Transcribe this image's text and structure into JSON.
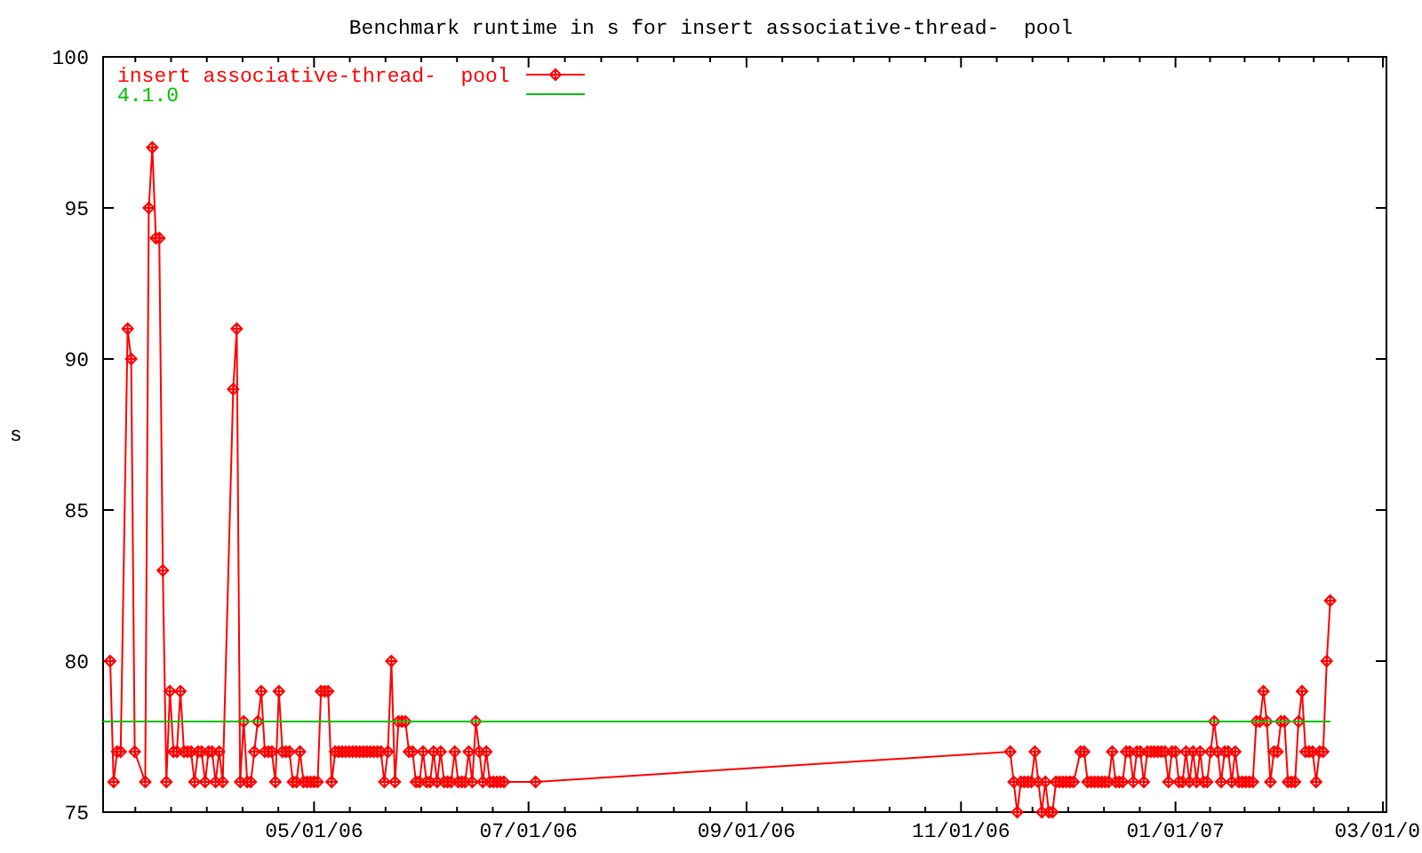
{
  "chart": {
    "chart_data": {
      "type": "line",
      "title": "Benchmark runtime in s for insert associative-thread-  pool",
      "ylabel": "s",
      "xlim": [
        "2006-03-02",
        "2007-03-02"
      ],
      "ylim": [
        75,
        100
      ],
      "xticks": [
        {
          "value": "2006-05-01",
          "label": "05/01/06"
        },
        {
          "value": "2006-07-01",
          "label": "07/01/06"
        },
        {
          "value": "2006-09-01",
          "label": "09/01/06"
        },
        {
          "value": "2006-11-01",
          "label": "11/01/06"
        },
        {
          "value": "2007-01-01",
          "label": "01/01/07"
        },
        {
          "value": "2007-03-01",
          "label": "03/01/0"
        }
      ],
      "yticks": [
        75,
        80,
        85,
        90,
        95,
        100
      ],
      "x": [
        "2006-03-02",
        "2006-03-04",
        "2006-03-05",
        "2006-03-06",
        "2006-03-07",
        "2006-03-09",
        "2006-03-10",
        "2006-03-11",
        "2006-03-14",
        "2006-03-15",
        "2006-03-16",
        "2006-03-17",
        "2006-03-18",
        "2006-03-19",
        "2006-03-20",
        "2006-03-21",
        "2006-03-22",
        "2006-03-23",
        "2006-03-24",
        "2006-03-25",
        "2006-03-26",
        "2006-03-27",
        "2006-03-28",
        "2006-03-29",
        "2006-03-30",
        "2006-03-31",
        "2006-04-01",
        "2006-04-02",
        "2006-04-03",
        "2006-04-04",
        "2006-04-05",
        "2006-04-08",
        "2006-04-09",
        "2006-04-10",
        "2006-04-11",
        "2006-04-12",
        "2006-04-13",
        "2006-04-14",
        "2006-04-15",
        "2006-04-16",
        "2006-04-17",
        "2006-04-18",
        "2006-04-19",
        "2006-04-20",
        "2006-04-21",
        "2006-04-22",
        "2006-04-23",
        "2006-04-24",
        "2006-04-25",
        "2006-04-26",
        "2006-04-27",
        "2006-04-28",
        "2006-04-29",
        "2006-04-30",
        "2006-05-01",
        "2006-05-02",
        "2006-05-03",
        "2006-05-04",
        "2006-05-05",
        "2006-05-06",
        "2006-05-07",
        "2006-05-08",
        "2006-05-09",
        "2006-05-10",
        "2006-05-11",
        "2006-05-12",
        "2006-05-13",
        "2006-05-14",
        "2006-05-15",
        "2006-05-16",
        "2006-05-17",
        "2006-05-18",
        "2006-05-19",
        "2006-05-20",
        "2006-05-21",
        "2006-05-22",
        "2006-05-23",
        "2006-05-24",
        "2006-05-25",
        "2006-05-26",
        "2006-05-27",
        "2006-05-28",
        "2006-05-29",
        "2006-05-30",
        "2006-05-31",
        "2006-06-01",
        "2006-06-02",
        "2006-06-03",
        "2006-06-04",
        "2006-06-05",
        "2006-06-06",
        "2006-06-07",
        "2006-06-08",
        "2006-06-09",
        "2006-06-10",
        "2006-06-11",
        "2006-06-12",
        "2006-06-13",
        "2006-06-14",
        "2006-06-15",
        "2006-06-16",
        "2006-06-17",
        "2006-06-18",
        "2006-06-19",
        "2006-06-20",
        "2006-06-21",
        "2006-06-22",
        "2006-06-23",
        "2006-06-24",
        "2006-07-03",
        "2006-11-15",
        "2006-11-16",
        "2006-11-17",
        "2006-11-18",
        "2006-11-19",
        "2006-11-20",
        "2006-11-21",
        "2006-11-22",
        "2006-11-23",
        "2006-11-24",
        "2006-11-25",
        "2006-11-26",
        "2006-11-27",
        "2006-11-28",
        "2006-11-29",
        "2006-11-30",
        "2006-12-01",
        "2006-12-02",
        "2006-12-03",
        "2006-12-05",
        "2006-12-06",
        "2006-12-07",
        "2006-12-08",
        "2006-12-09",
        "2006-12-10",
        "2006-12-11",
        "2006-12-12",
        "2006-12-13",
        "2006-12-14",
        "2006-12-15",
        "2006-12-16",
        "2006-12-17",
        "2006-12-18",
        "2006-12-19",
        "2006-12-20",
        "2006-12-21",
        "2006-12-22",
        "2006-12-23",
        "2006-12-24",
        "2006-12-25",
        "2006-12-26",
        "2006-12-27",
        "2006-12-28",
        "2006-12-29",
        "2006-12-30",
        "2006-12-31",
        "2007-01-01",
        "2007-01-02",
        "2007-01-03",
        "2007-01-04",
        "2007-01-05",
        "2007-01-06",
        "2007-01-07",
        "2007-01-08",
        "2007-01-09",
        "2007-01-10",
        "2007-01-11",
        "2007-01-12",
        "2007-01-13",
        "2007-01-14",
        "2007-01-15",
        "2007-01-16",
        "2007-01-17",
        "2007-01-18",
        "2007-01-19",
        "2007-01-20",
        "2007-01-21",
        "2007-01-22",
        "2007-01-23",
        "2007-01-24",
        "2007-01-25",
        "2007-01-26",
        "2007-01-27",
        "2007-01-28",
        "2007-01-29",
        "2007-01-30",
        "2007-01-31",
        "2007-02-01",
        "2007-02-02",
        "2007-02-03",
        "2007-02-04",
        "2007-02-05",
        "2007-02-06",
        "2007-02-07",
        "2007-02-08",
        "2007-02-09",
        "2007-02-10",
        "2007-02-11",
        "2007-02-12",
        "2007-02-13",
        "2007-02-14"
      ],
      "series": [
        {
          "name": "insert associative-thread-  pool",
          "color": "#ff0000",
          "values": [
            null,
            80,
            76,
            77,
            77,
            91,
            90,
            77,
            76,
            95,
            97,
            94,
            94,
            83,
            76,
            79,
            77,
            77,
            79,
            77,
            77,
            77,
            76,
            77,
            77,
            76,
            77,
            77,
            76,
            77,
            76,
            89,
            91,
            76,
            78,
            76,
            76,
            77,
            78,
            79,
            77,
            77,
            77,
            76,
            79,
            77,
            77,
            77,
            76,
            76,
            77,
            76,
            76,
            76,
            76,
            76,
            79,
            79,
            79,
            76,
            77,
            77,
            77,
            77,
            77,
            77,
            77,
            77,
            77,
            77,
            77,
            77,
            77,
            77,
            76,
            77,
            80,
            76,
            78,
            78,
            78,
            77,
            77,
            76,
            76,
            77,
            76,
            76,
            77,
            76,
            77,
            76,
            76,
            76,
            77,
            76,
            76,
            76,
            77,
            76,
            78,
            77,
            76,
            77,
            76,
            76,
            76,
            76,
            76,
            76,
            77,
            76,
            75,
            76,
            76,
            76,
            76,
            77,
            76,
            75,
            76,
            75,
            75,
            76,
            76,
            76,
            76,
            76,
            76,
            77,
            77,
            76,
            76,
            76,
            76,
            76,
            76,
            76,
            77,
            76,
            76,
            76,
            77,
            77,
            76,
            77,
            77,
            76,
            77,
            77,
            77,
            77,
            77,
            77,
            76,
            77,
            77,
            76,
            76,
            77,
            76,
            77,
            76,
            77,
            76,
            76,
            77,
            78,
            77,
            76,
            77,
            77,
            76,
            77,
            76,
            76,
            76,
            76,
            76,
            78,
            78,
            79,
            78,
            76,
            77,
            77,
            78,
            78,
            76,
            76,
            76,
            78,
            79,
            77,
            77,
            77,
            76,
            77,
            77,
            80,
            82
          ]
        },
        {
          "name": "4.1.0",
          "color": "#00c000",
          "values": [
            78,
            78,
            78,
            78,
            78,
            78,
            78,
            78,
            78,
            78,
            78,
            78,
            78,
            78,
            78,
            78,
            78,
            78,
            78,
            78,
            78,
            78,
            78,
            78,
            78,
            78,
            78,
            78,
            78,
            78,
            78,
            78,
            78,
            78,
            78,
            78,
            78,
            78,
            78,
            78,
            78,
            78,
            78,
            78,
            78,
            78,
            78,
            78,
            78,
            78,
            78,
            78,
            78,
            78,
            78,
            78,
            78,
            78,
            78,
            78,
            78,
            78,
            78,
            78,
            78,
            78,
            78,
            78,
            78,
            78,
            78,
            78,
            78,
            78,
            78,
            78,
            78,
            78,
            78,
            78,
            78,
            78,
            78,
            78,
            78,
            78,
            78,
            78,
            78,
            78,
            78,
            78,
            78,
            78,
            78,
            78,
            78,
            78,
            78,
            78,
            78,
            78,
            78,
            78,
            78,
            78,
            78,
            78,
            78,
            78,
            78,
            78,
            78,
            78,
            78,
            78,
            78,
            78,
            78,
            78,
            78,
            78,
            78,
            78,
            78,
            78,
            78,
            78,
            78,
            78,
            78,
            78,
            78,
            78,
            78,
            78,
            78,
            78,
            78,
            78,
            78,
            78,
            78,
            78,
            78,
            78,
            78,
            78,
            78,
            78,
            78,
            78,
            78,
            78,
            78,
            78,
            78,
            78,
            78,
            78,
            78,
            78,
            78,
            78,
            78,
            78,
            78,
            78,
            78,
            78,
            78,
            78,
            78,
            78,
            78,
            78,
            78,
            78,
            78,
            78,
            78,
            78,
            78,
            78,
            78,
            78,
            78,
            78,
            78,
            78,
            78,
            78,
            78,
            78,
            78,
            78,
            78,
            78,
            78,
            78,
            78
          ]
        }
      ]
    }
  }
}
